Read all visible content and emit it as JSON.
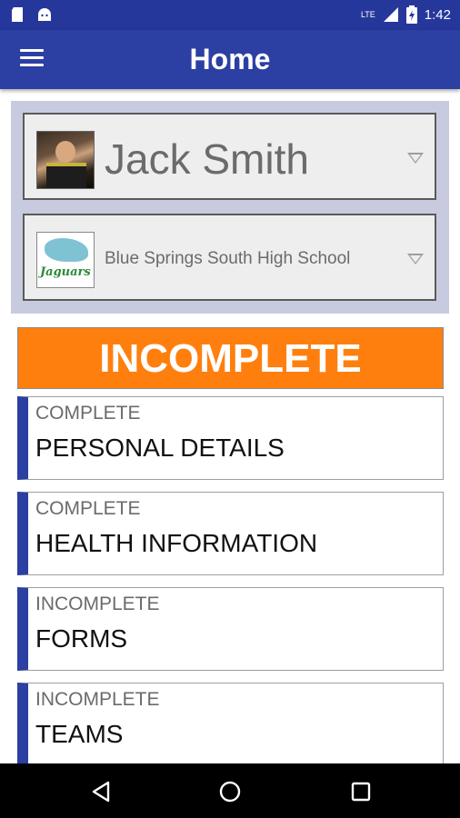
{
  "status_bar": {
    "time": "1:42",
    "signal_label": "LTE"
  },
  "app_bar": {
    "title": "Home"
  },
  "athlete_selector": {
    "selected": "Jack Smith"
  },
  "school_selector": {
    "selected": "Blue Springs South High School",
    "logo_text": "Jaguars"
  },
  "overall_status": {
    "label": "INCOMPLETE",
    "color": "#ff7f0e"
  },
  "sections": [
    {
      "status": "COMPLETE",
      "title": "PERSONAL DETAILS"
    },
    {
      "status": "COMPLETE",
      "title": "HEALTH INFORMATION"
    },
    {
      "status": "INCOMPLETE",
      "title": "FORMS"
    },
    {
      "status": "INCOMPLETE",
      "title": "TEAMS"
    }
  ],
  "colors": {
    "primary": "#2c3fa3",
    "accent": "#ff7f0e"
  },
  "icons": {
    "menu": "hamburger-icon",
    "back": "back-triangle-icon",
    "home": "home-circle-icon",
    "recent": "recent-square-icon"
  }
}
